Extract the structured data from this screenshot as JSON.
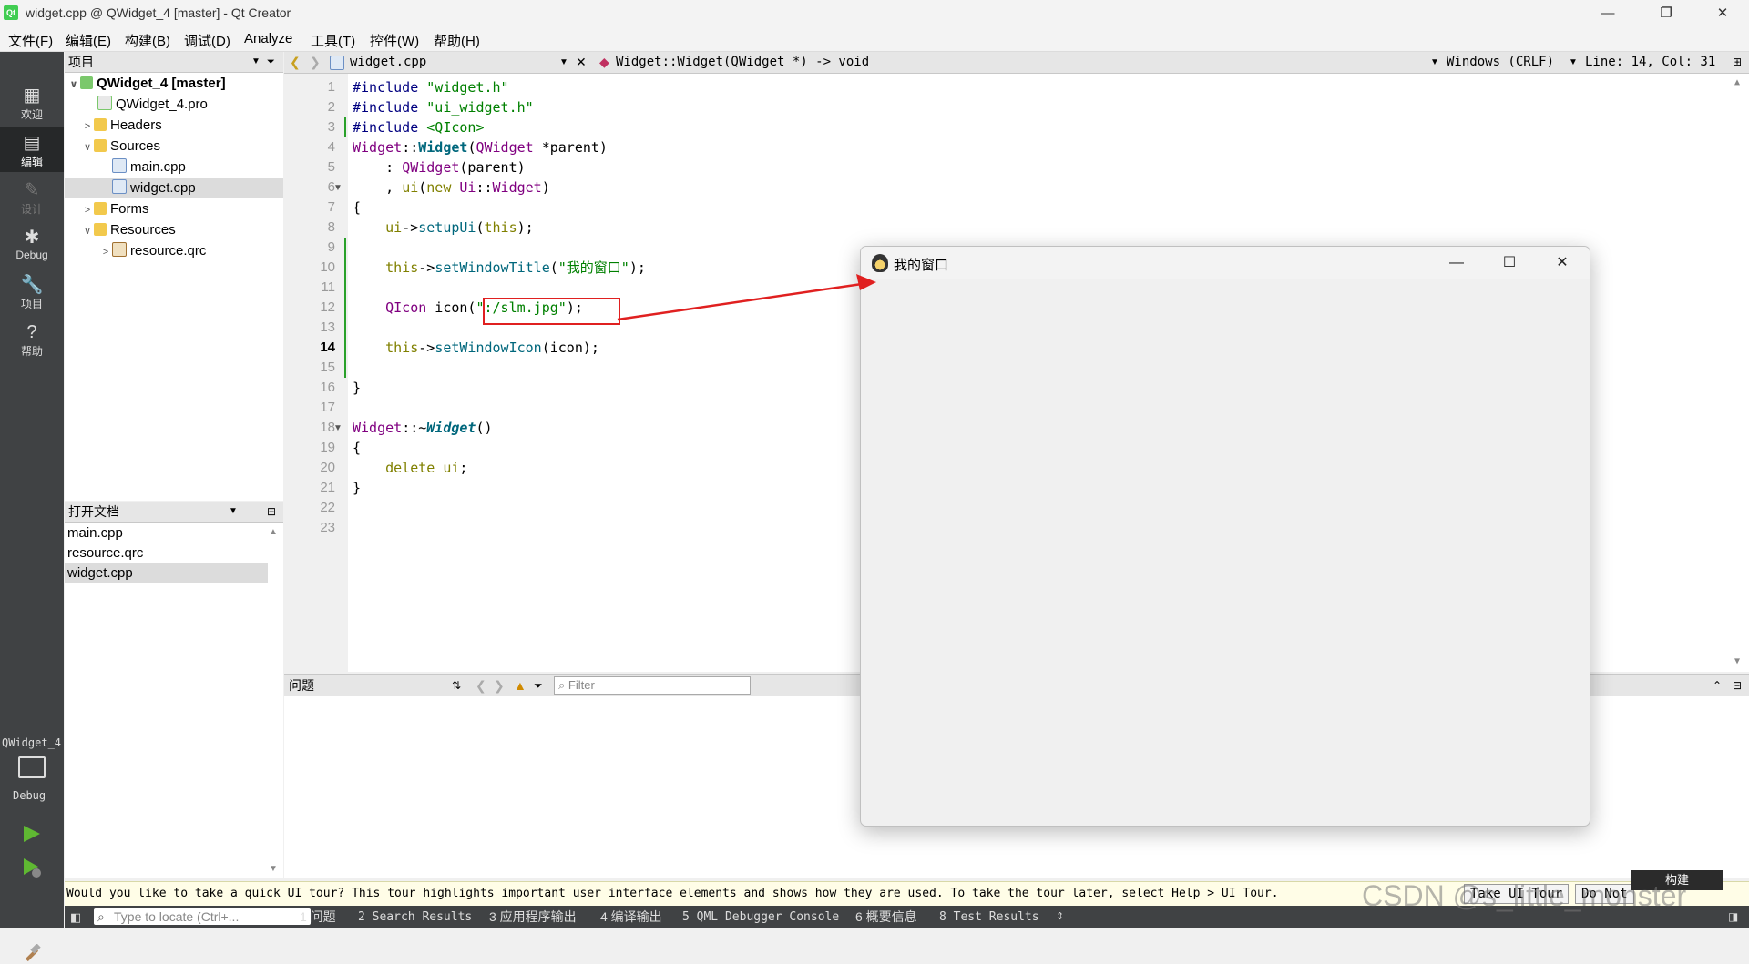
{
  "window": {
    "title": "widget.cpp @ QWidget_4 [master] - Qt Creator",
    "app_icon_text": "Qt",
    "minimize": "—",
    "restore": "❐",
    "close": "✕"
  },
  "menu": [
    "文件(F)",
    "编辑(E)",
    "构建(B)",
    "调试(D)",
    "Analyze",
    "工具(T)",
    "控件(W)",
    "帮助(H)"
  ],
  "modes": [
    {
      "label": "欢迎",
      "glyph": "▦"
    },
    {
      "label": "编辑",
      "glyph": "▤"
    },
    {
      "label": "设计",
      "glyph": "✎"
    },
    {
      "label": "Debug",
      "glyph": "✱"
    },
    {
      "label": "项目",
      "glyph": "🔧"
    },
    {
      "label": "帮助",
      "glyph": "?"
    }
  ],
  "kit": {
    "project": "QWidget_4",
    "config": "Debug"
  },
  "project_pane": {
    "title": "项目",
    "tree": [
      {
        "label": "QWidget_4 [master]",
        "arrow": "∨"
      },
      {
        "label": "QWidget_4.pro",
        "arrow": ""
      },
      {
        "label": "Headers",
        "arrow": ">"
      },
      {
        "label": "Sources",
        "arrow": "∨"
      },
      {
        "label": "main.cpp",
        "arrow": ""
      },
      {
        "label": "widget.cpp",
        "arrow": ""
      },
      {
        "label": "Forms",
        "arrow": ">"
      },
      {
        "label": "Resources",
        "arrow": "∨"
      },
      {
        "label": "resource.qrc",
        "arrow": ">"
      }
    ]
  },
  "open_docs": {
    "title": "打开文档",
    "items": [
      "main.cpp",
      "resource.qrc",
      "widget.cpp"
    ]
  },
  "editor": {
    "file": "widget.cpp",
    "symbol": "Widget::Widget(QWidget *) -> void",
    "line_ending": "Windows (CRLF)",
    "position": "Line: 14, Col: 31",
    "current_line": 14,
    "line_count": 23
  },
  "issues": {
    "title": "问题",
    "filter_placeholder": "Filter"
  },
  "infobar": {
    "message": "Would you like to take a quick UI tour? This tour highlights important user interface elements and shows how they are used. To take the tour later, select Help > UI Tour.",
    "take_tour": "Take UI Tour",
    "do_not": "Do Not"
  },
  "statusbar": {
    "locator_placeholder": "Type to locate (Ctrl+...",
    "tabs": [
      "1 问题",
      "2 Search Results",
      "3 应用程序输出",
      "4 编译输出",
      "5 QML Debugger Console",
      "6 概要信息",
      "8 Test Results"
    ]
  },
  "popup": {
    "title": "我的窗口",
    "minimize": "—",
    "maximize": "☐",
    "close": "✕"
  },
  "build_label": "构建",
  "watermark": "CSDN @s_little_monster",
  "colors": {
    "accent_highlight": "#e02020",
    "mode_bar": "#404244",
    "modified_marker": "#2aa12a"
  }
}
